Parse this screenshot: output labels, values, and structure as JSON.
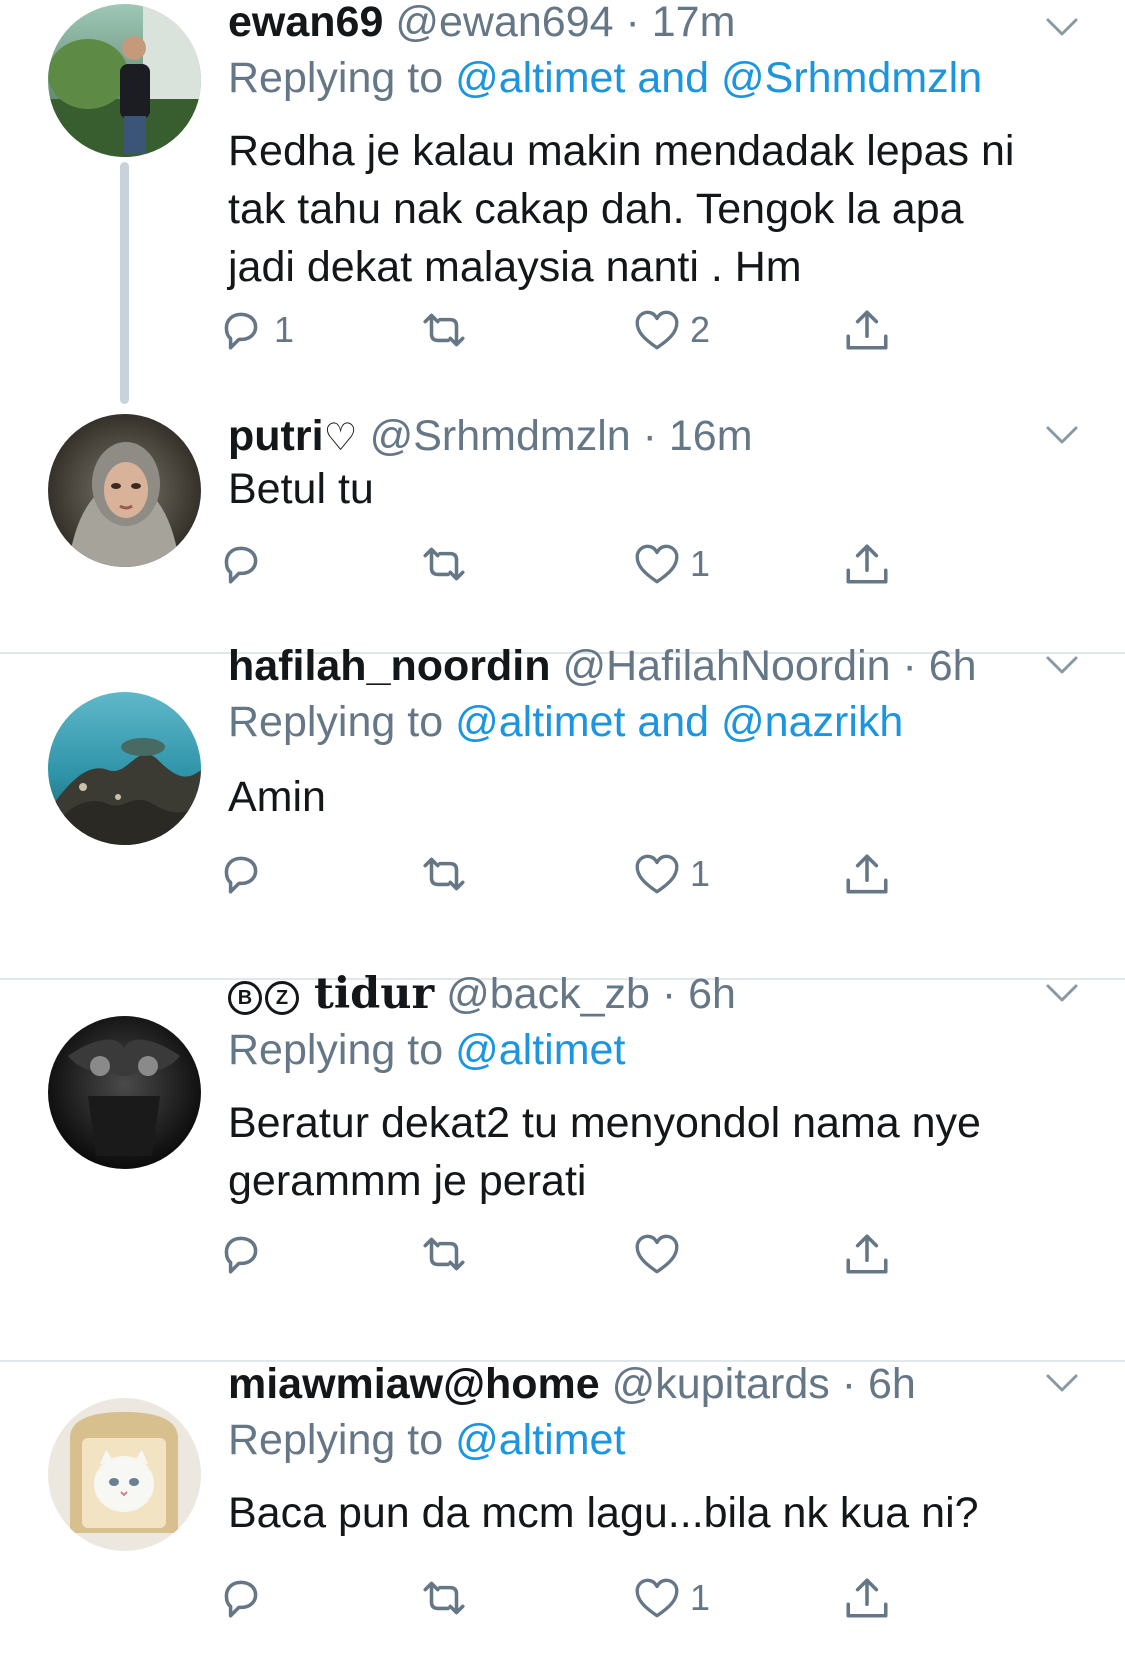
{
  "tweets": [
    {
      "name": "ewan69",
      "handle": "@ewan694",
      "time": "17m",
      "replying_prefix": "Replying to",
      "replying_to": "@altimet and @Srhmdmzln",
      "text_lines": [
        "Redha je kalau makin mendadak lepas ni",
        "tak tahu nak cakap dah. Tengok la apa",
        "jadi dekat malaysia nanti . Hm"
      ],
      "reply_count": "1",
      "retweet_count": "",
      "like_count": "2"
    },
    {
      "name": "putri",
      "name_suffix": "♡",
      "handle": "@Srhmdmzln",
      "time": "16m",
      "text_lines": [
        "Betul tu"
      ],
      "reply_count": "",
      "retweet_count": "",
      "like_count": "1"
    },
    {
      "name": "hafilah_noordin",
      "handle": "@HafilahNoordin",
      "time": "6h",
      "replying_prefix": "Replying to",
      "replying_to": "@altimet and @nazrikh",
      "text_lines": [
        "Amin"
      ],
      "reply_count": "",
      "retweet_count": "",
      "like_count": "1"
    },
    {
      "name_badges": [
        "B",
        "Z"
      ],
      "name": "tidur",
      "handle": "@back_zb",
      "time": "6h",
      "replying_prefix": "Replying to",
      "replying_to": "@altimet",
      "text_lines": [
        "Beratur dekat2 tu menyondol nama nye",
        "gerammm je perati"
      ],
      "reply_count": "",
      "retweet_count": "",
      "like_count": ""
    },
    {
      "name": "miawmiaw@home",
      "handle": "@kupitards",
      "time": "6h",
      "replying_prefix": "Replying to",
      "replying_to": "@altimet",
      "text_lines": [
        "Baca pun da mcm lagu...bila nk kua ni?"
      ],
      "reply_count": "",
      "retweet_count": "",
      "like_count": "1"
    }
  ],
  "icons": {
    "reply": "reply-icon",
    "retweet": "retweet-icon",
    "like": "heart-icon",
    "share": "share-icon",
    "menu": "chevron-down-icon"
  },
  "colors": {
    "text": "#14171a",
    "secondary": "#657786",
    "link": "#1b95e0",
    "divider": "#e1e8ed",
    "thread_line": "#c8d2da"
  }
}
